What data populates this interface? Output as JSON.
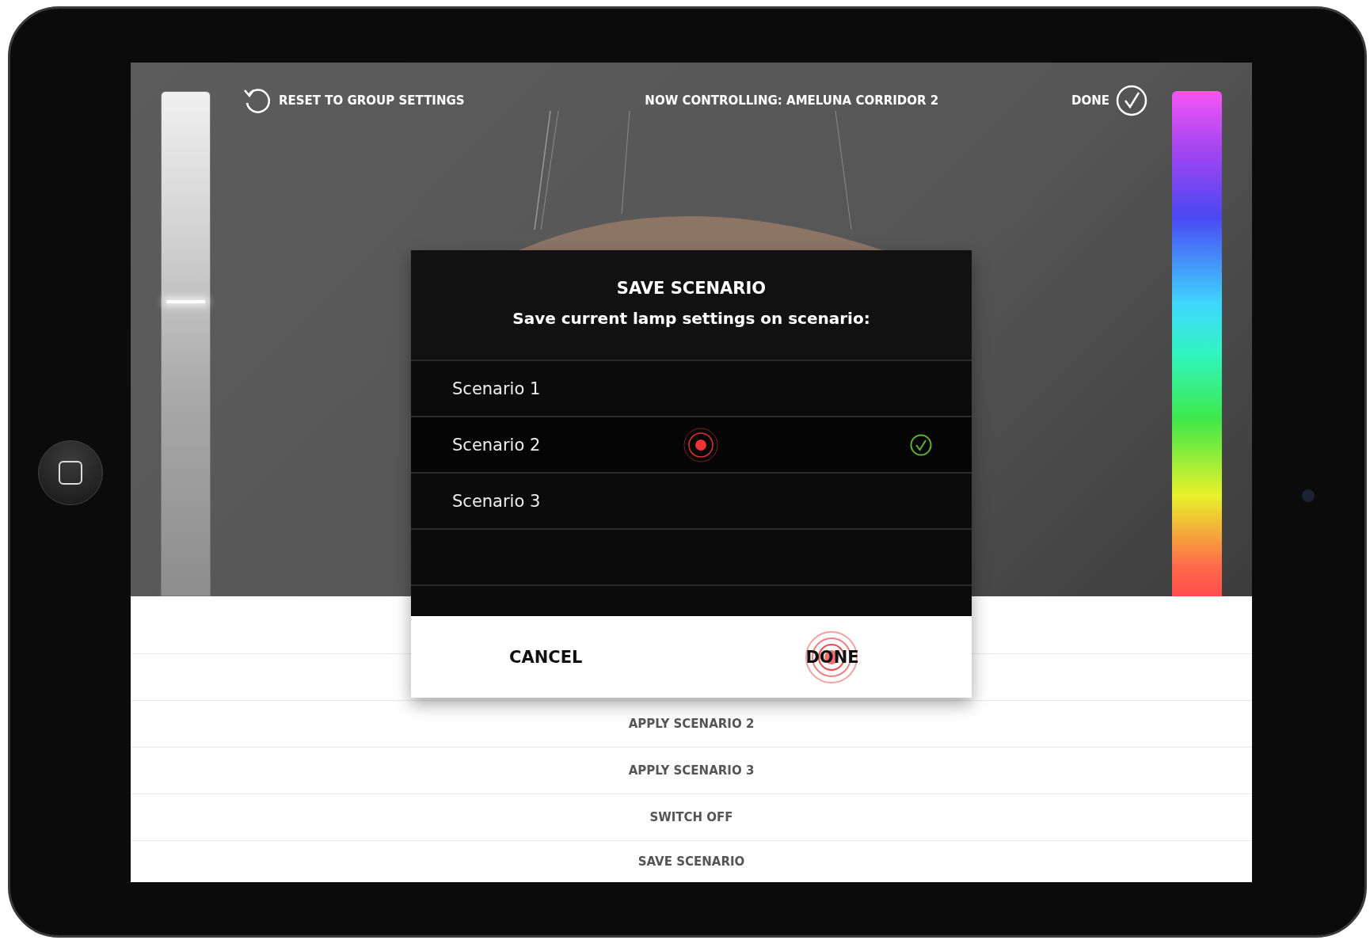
{
  "top_bar": {
    "reset_label": "RESET TO GROUP SETTINGS",
    "now_controlling": "NOW CONTROLLING: AMELUNA CORRIDOR 2",
    "done_label": "DONE"
  },
  "brightness_slider": {
    "level": 0.58
  },
  "dialog": {
    "title": "SAVE SCENARIO",
    "subtitle": "Save current lamp settings on scenario:",
    "scenarios": [
      {
        "label": "Scenario 1",
        "selected": false
      },
      {
        "label": "Scenario 2",
        "selected": true
      },
      {
        "label": "Scenario 3",
        "selected": false
      }
    ],
    "cancel_label": "CANCEL",
    "done_label": "DONE"
  },
  "actions": [
    "APPLY SCENARIO 2",
    "APPLY SCENARIO 3",
    "SWITCH OFF",
    "SAVE SCENARIO"
  ]
}
